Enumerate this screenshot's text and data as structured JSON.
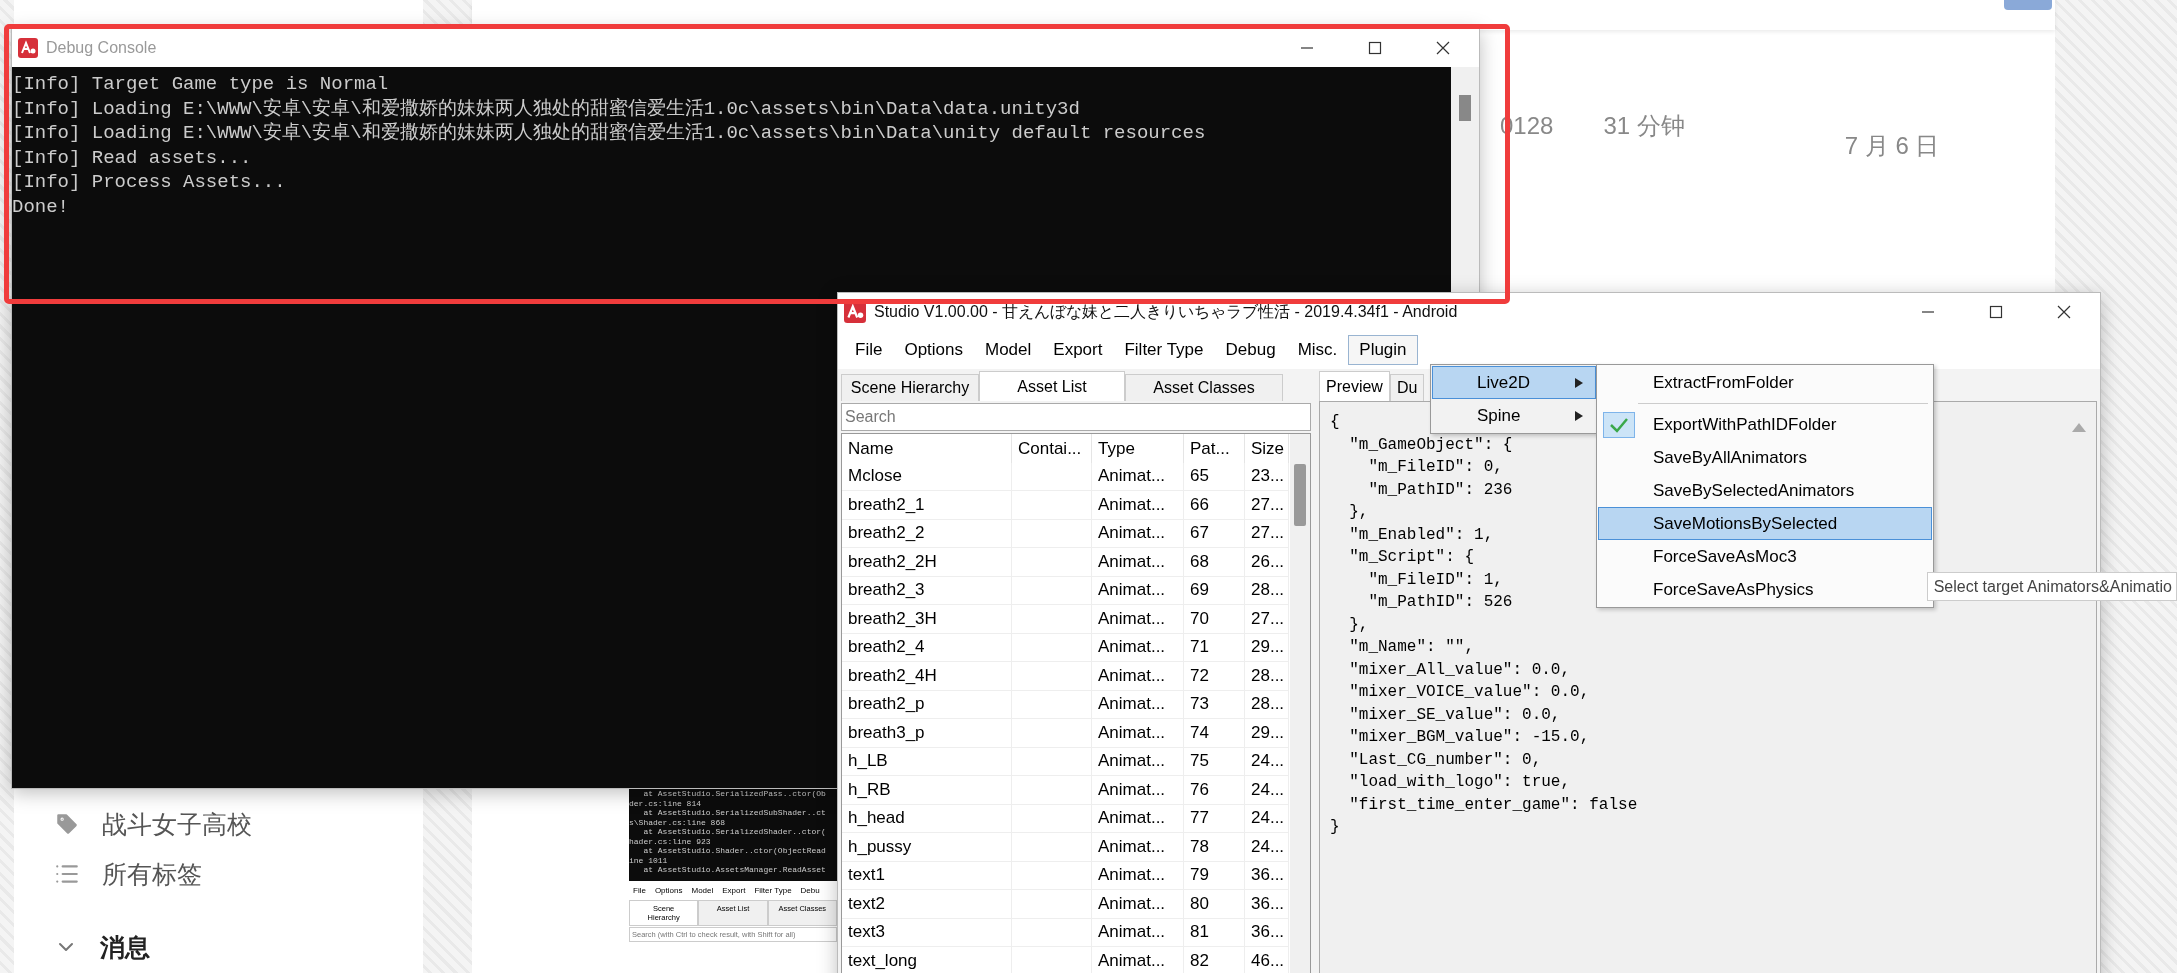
{
  "page": {
    "stats": [
      "0128",
      "31 分钟"
    ],
    "date": "7 月 6 日",
    "tags": [
      {
        "label": "战斗女子高校",
        "kind": "tag"
      },
      {
        "label": "所有标签",
        "kind": "list"
      }
    ],
    "section": {
      "label": "消息",
      "expanded": true
    }
  },
  "console": {
    "title": "Debug Console",
    "lines": [
      "[Info] Target Game type is Normal",
      "[Info] Loading E:\\WWW\\安卓\\安卓\\和爱撒娇的妹妹两人独处的甜蜜信爱生活1.0c\\assets\\bin\\Data\\data.unity3d",
      "[Info] Loading E:\\WWW\\安卓\\安卓\\和爱撒娇的妹妹两人独处的甜蜜信爱生活1.0c\\assets\\bin\\Data\\unity default resources",
      "[Info] Read assets...",
      "[Info] Process Assets...",
      "Done!"
    ]
  },
  "thumbnail": {
    "log_lines": [
      "   at AssetStudio.SerializedPass..ctor(Ob",
      "der.cs:line 814",
      "   at AssetStudio.SerializedSubShader..ct",
      "s\\Shader.cs:line 868",
      "   at AssetStudio.SerializedShader..ctor(",
      "hader.cs:line 923",
      "   at AssetStudio.Shader..ctor(ObjectRead",
      "ine 1011",
      "   at AssetStudio.AssetsManager.ReadAsset"
    ],
    "menu": [
      "File",
      "Options",
      "Model",
      "Export",
      "Filter Type",
      "Debu"
    ],
    "tabs": [
      {
        "label": "Scene Hierarchy",
        "selected": true
      },
      {
        "label": "Asset List",
        "selected": false
      },
      {
        "label": "Asset Classes",
        "selected": false
      }
    ],
    "search": {
      "placeholder": "Search (with Ctrl to check result, with Shift for all)"
    }
  },
  "studio": {
    "title": "Studio V1.00.00 - 甘えんぼな妹と二人きりいちゃラブ性活 - 2019.4.34f1 - Android",
    "menu": [
      {
        "label": "File",
        "selected": false
      },
      {
        "label": "Options",
        "selected": false
      },
      {
        "label": "Model",
        "selected": false
      },
      {
        "label": "Export",
        "selected": false
      },
      {
        "label": "Filter Type",
        "selected": false
      },
      {
        "label": "Debug",
        "selected": false
      },
      {
        "label": "Misc.",
        "selected": false
      },
      {
        "label": "Plugin",
        "selected": true
      }
    ],
    "plugin_menu": [
      {
        "label": "Live2D",
        "selected": true
      },
      {
        "label": "Spine",
        "selected": false
      }
    ],
    "live2d_menu": [
      {
        "kind": "item",
        "label": "ExtractFromFolder",
        "checked": false,
        "selected": false
      },
      {
        "kind": "separator"
      },
      {
        "kind": "item",
        "label": "ExportWithPathIDFolder",
        "checked": true,
        "selected": false
      },
      {
        "kind": "item",
        "label": "SaveByAllAnimators",
        "checked": false,
        "selected": false
      },
      {
        "kind": "item",
        "label": "SaveBySelectedAnimators",
        "checked": false,
        "selected": false
      },
      {
        "kind": "item",
        "label": "SaveMotionsBySelected",
        "checked": false,
        "selected": true
      },
      {
        "kind": "item",
        "label": "ForceSaveAsMoc3",
        "checked": false,
        "selected": false
      },
      {
        "kind": "item",
        "label": "ForceSaveAsPhysics",
        "checked": false,
        "selected": false
      }
    ],
    "tooltip": "Select target Animators&Animatio",
    "left_tabs": [
      {
        "label": "Scene Hierarchy",
        "selected": false
      },
      {
        "label": "Asset List",
        "selected": true
      },
      {
        "label": "Asset Classes",
        "selected": false
      }
    ],
    "search": {
      "placeholder": "Search"
    },
    "columns": [
      "Name",
      "Contai...",
      "Type",
      "Pat...",
      "Size"
    ],
    "rows": [
      {
        "name": "Mclose",
        "type": "Animat...",
        "path_id": "65",
        "size": "23..."
      },
      {
        "name": "breath2_1",
        "type": "Animat...",
        "path_id": "66",
        "size": "27..."
      },
      {
        "name": "breath2_2",
        "type": "Animat...",
        "path_id": "67",
        "size": "27..."
      },
      {
        "name": "breath2_2H",
        "type": "Animat...",
        "path_id": "68",
        "size": "26..."
      },
      {
        "name": "breath2_3",
        "type": "Animat...",
        "path_id": "69",
        "size": "28..."
      },
      {
        "name": "breath2_3H",
        "type": "Animat...",
        "path_id": "70",
        "size": "27..."
      },
      {
        "name": "breath2_4",
        "type": "Animat...",
        "path_id": "71",
        "size": "29..."
      },
      {
        "name": "breath2_4H",
        "type": "Animat...",
        "path_id": "72",
        "size": "28..."
      },
      {
        "name": "breath2_p",
        "type": "Animat...",
        "path_id": "73",
        "size": "28..."
      },
      {
        "name": "breath3_p",
        "type": "Animat...",
        "path_id": "74",
        "size": "29..."
      },
      {
        "name": "h_LB",
        "type": "Animat...",
        "path_id": "75",
        "size": "24..."
      },
      {
        "name": "h_RB",
        "type": "Animat...",
        "path_id": "76",
        "size": "24..."
      },
      {
        "name": "h_head",
        "type": "Animat...",
        "path_id": "77",
        "size": "24..."
      },
      {
        "name": "h_pussy",
        "type": "Animat...",
        "path_id": "78",
        "size": "24..."
      },
      {
        "name": "text1",
        "type": "Animat...",
        "path_id": "79",
        "size": "36..."
      },
      {
        "name": "text2",
        "type": "Animat...",
        "path_id": "80",
        "size": "36..."
      },
      {
        "name": "text3",
        "type": "Animat...",
        "path_id": "81",
        "size": "36..."
      },
      {
        "name": "text_long",
        "type": "Animat...",
        "path_id": "82",
        "size": "46..."
      }
    ],
    "right_tabs": [
      {
        "label": "Preview",
        "selected": true
      },
      {
        "label": "Du",
        "selected": false
      }
    ],
    "preview_lines": [
      "{",
      "  \"m_GameObject\": {",
      "    \"m_FileID\": 0,",
      "    \"m_PathID\": 236",
      "  },",
      "  \"m_Enabled\": 1,",
      "  \"m_Script\": {",
      "    \"m_FileID\": 1,",
      "    \"m_PathID\": 526",
      "  },",
      "  \"m_Name\": \"\",",
      "  \"mixer_All_value\": 0.0,",
      "  \"mixer_VOICE_value\": 0.0,",
      "  \"mixer_SE_value\": 0.0,",
      "  \"mixer_BGM_value\": -15.0,",
      "  \"Last_CG_number\": 0,",
      "  \"load_with_logo\": true,",
      "  \"first_time_enter_game\": false",
      "}"
    ]
  }
}
